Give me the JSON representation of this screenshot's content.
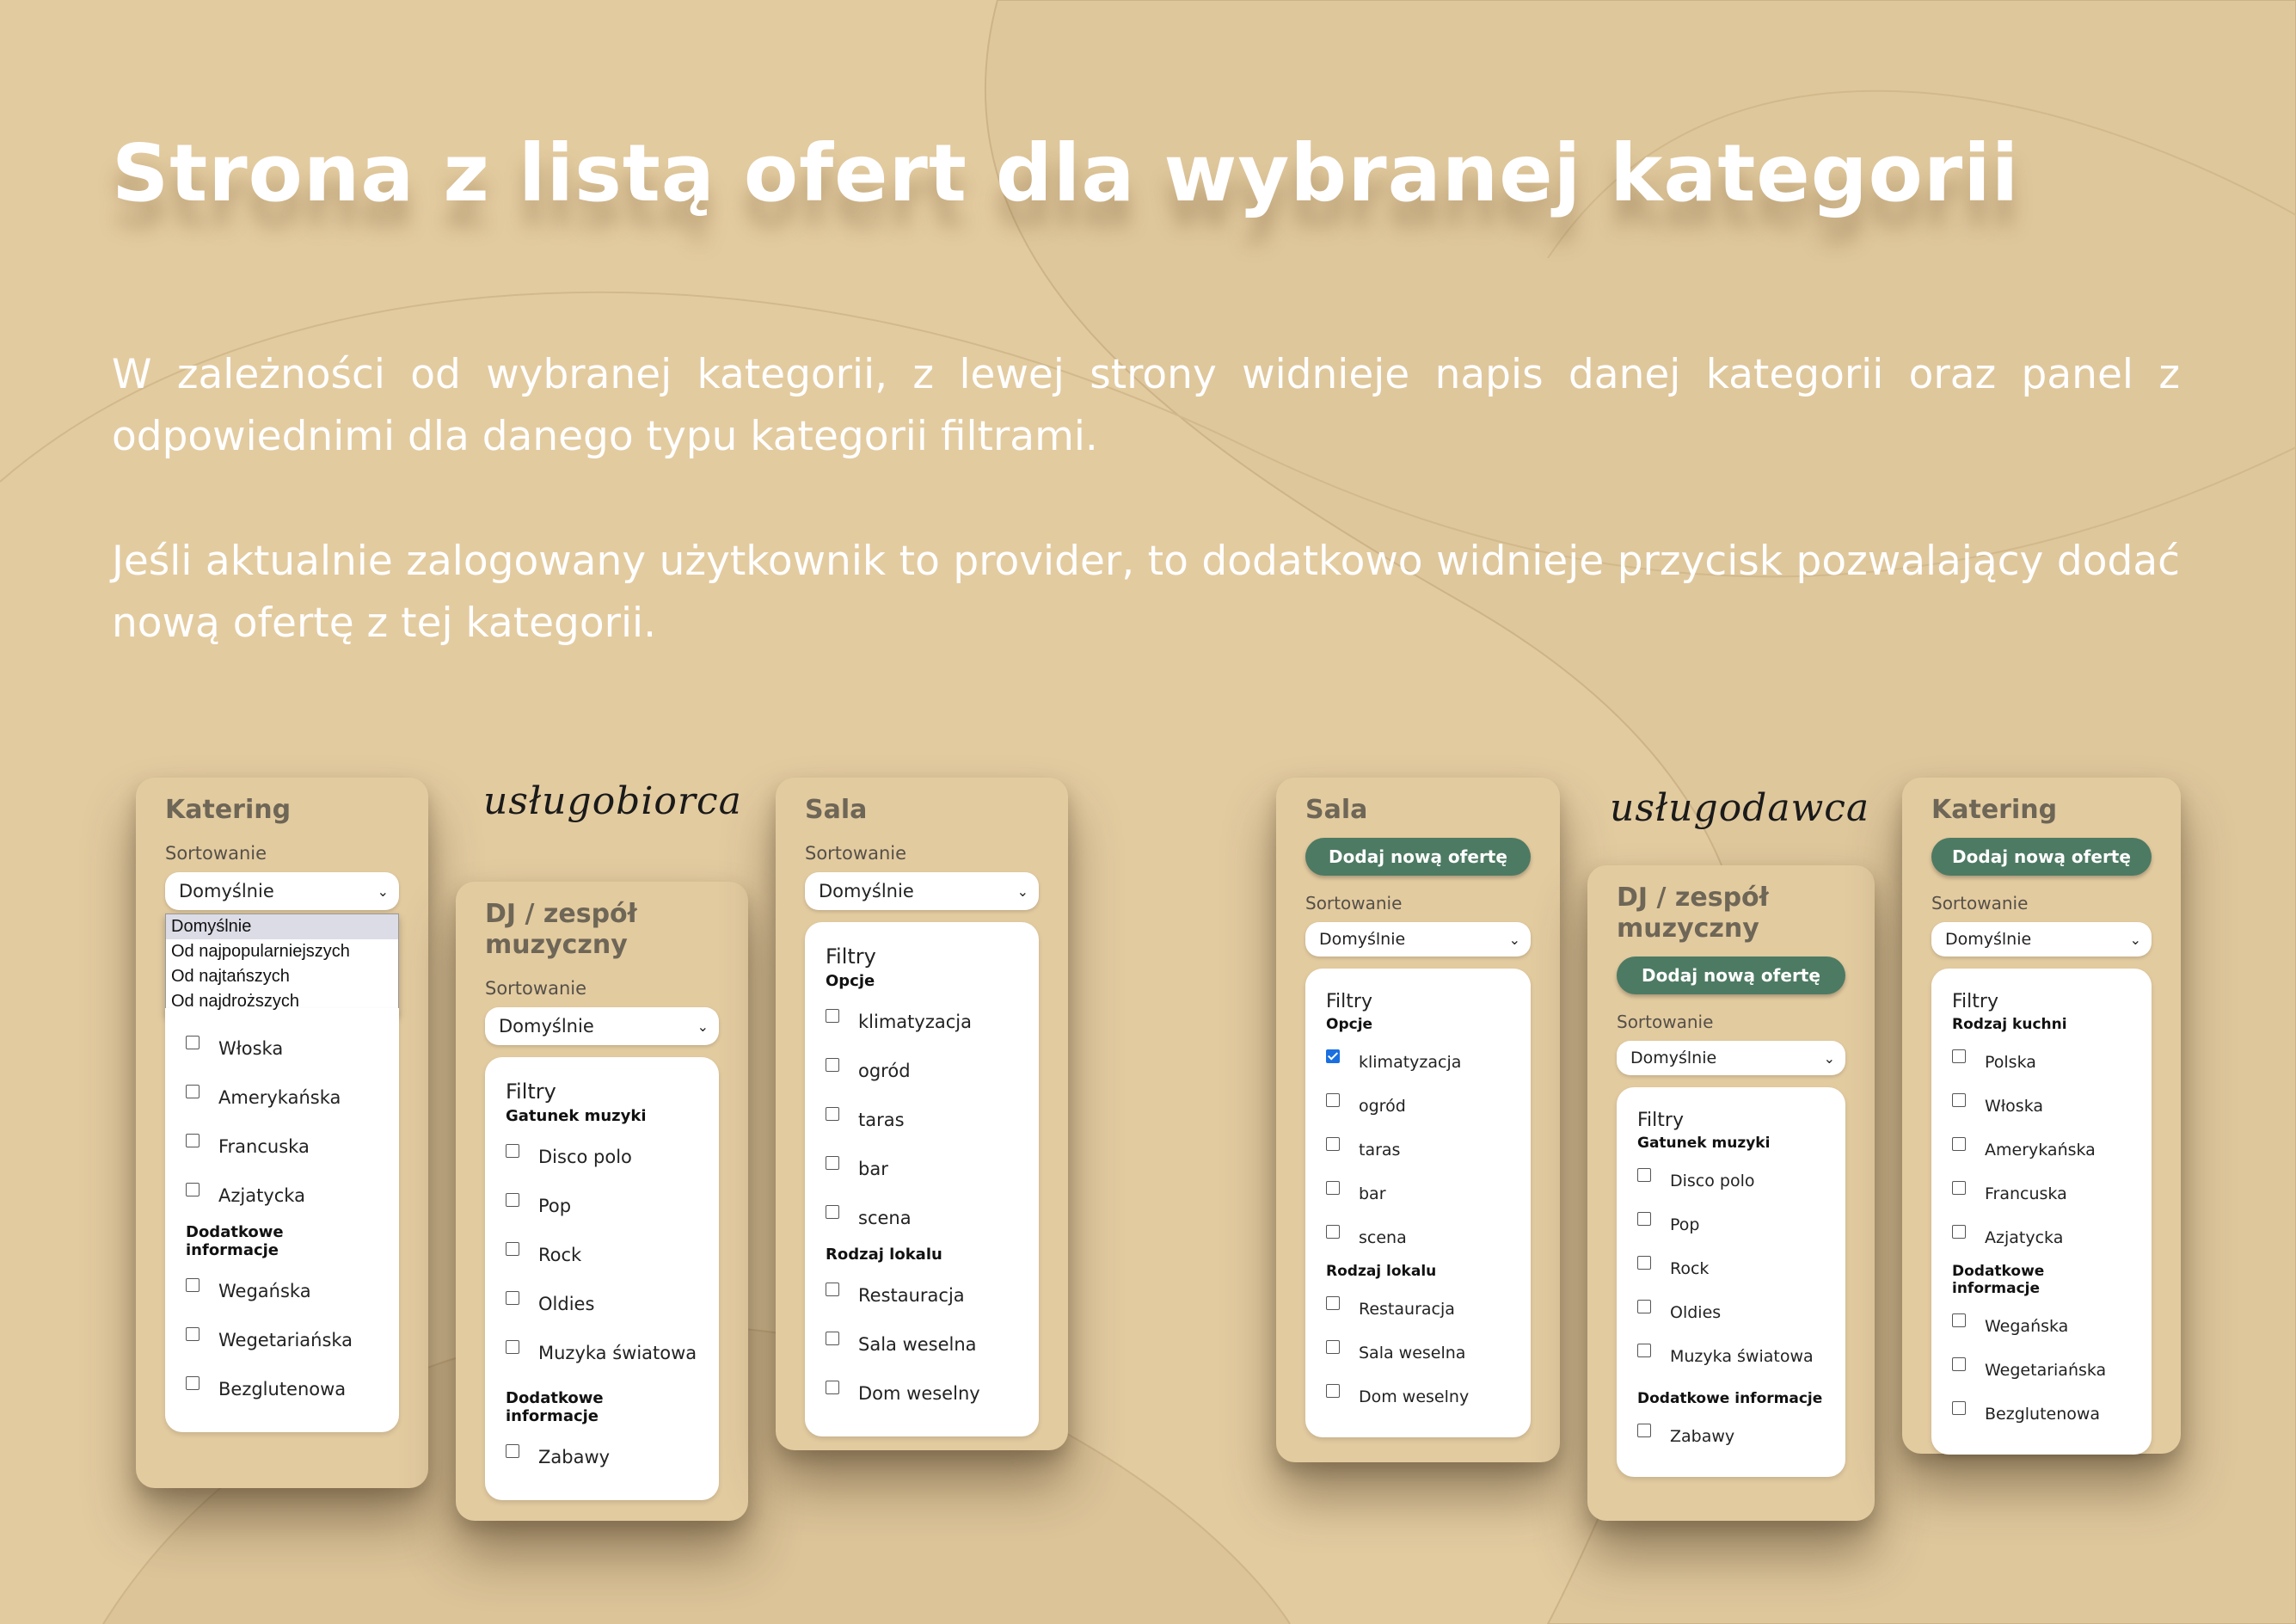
{
  "heading": "Strona z listą ofert dla wybranej kategorii",
  "paragraph1": "W zależności od wybranej kategorii, z lewej strony widnieje napis danej kategorii oraz panel z odpowiednimi dla danego typu kategorii filtrami.",
  "paragraph2": "Jeśli aktualnie zalogowany użytkownik to provider, to dodatkowo widnieje przycisk pozwalający dodać nową ofertę z tej kategorii.",
  "script_left": "usługobiorca",
  "script_right": "usługodawca",
  "common": {
    "sort_label": "Sortowanie",
    "sort_value": "Domyślnie",
    "filters_title": "Filtry",
    "add_button": "Dodaj nową ofertę"
  },
  "panel_katering_client": {
    "title": "Katering",
    "dropdown": [
      "Domyślnie",
      "Od najpopularniejszych",
      "Od najtańszych",
      "Od najdroższych"
    ],
    "group1_options": [
      "Włoska",
      "Amerykańska",
      "Francuska",
      "Azjatycka"
    ],
    "group2_title": "Dodatkowe informacje",
    "group2_options": [
      "Wegańska",
      "Wegetariańska",
      "Bezglutenowa"
    ]
  },
  "panel_dj_client": {
    "title": "DJ / zespół muzyczny",
    "group1_title": "Gatunek muzyki",
    "group1_options": [
      "Disco polo",
      "Pop",
      "Rock",
      "Oldies",
      "Muzyka światowa"
    ],
    "group2_title": "Dodatkowe informacje",
    "group2_options": [
      "Zabawy"
    ]
  },
  "panel_sala_client": {
    "title": "Sala",
    "group1_title": "Opcje",
    "group1_options": [
      "klimatyzacja",
      "ogród",
      "taras",
      "bar",
      "scena"
    ],
    "group2_title": "Rodzaj lokalu",
    "group2_options": [
      "Restauracja",
      "Sala weselna",
      "Dom weselny"
    ]
  },
  "panel_sala_provider": {
    "title": "Sala",
    "checked": "klimatyzacja"
  },
  "panel_dj_provider": {
    "title": "DJ / zespół muzyczny"
  },
  "panel_katering_provider": {
    "title": "Katering",
    "group1_title": "Rodzaj kuchni",
    "group1_options": [
      "Polska",
      "Włoska",
      "Amerykańska",
      "Francuska",
      "Azjatycka"
    ]
  }
}
